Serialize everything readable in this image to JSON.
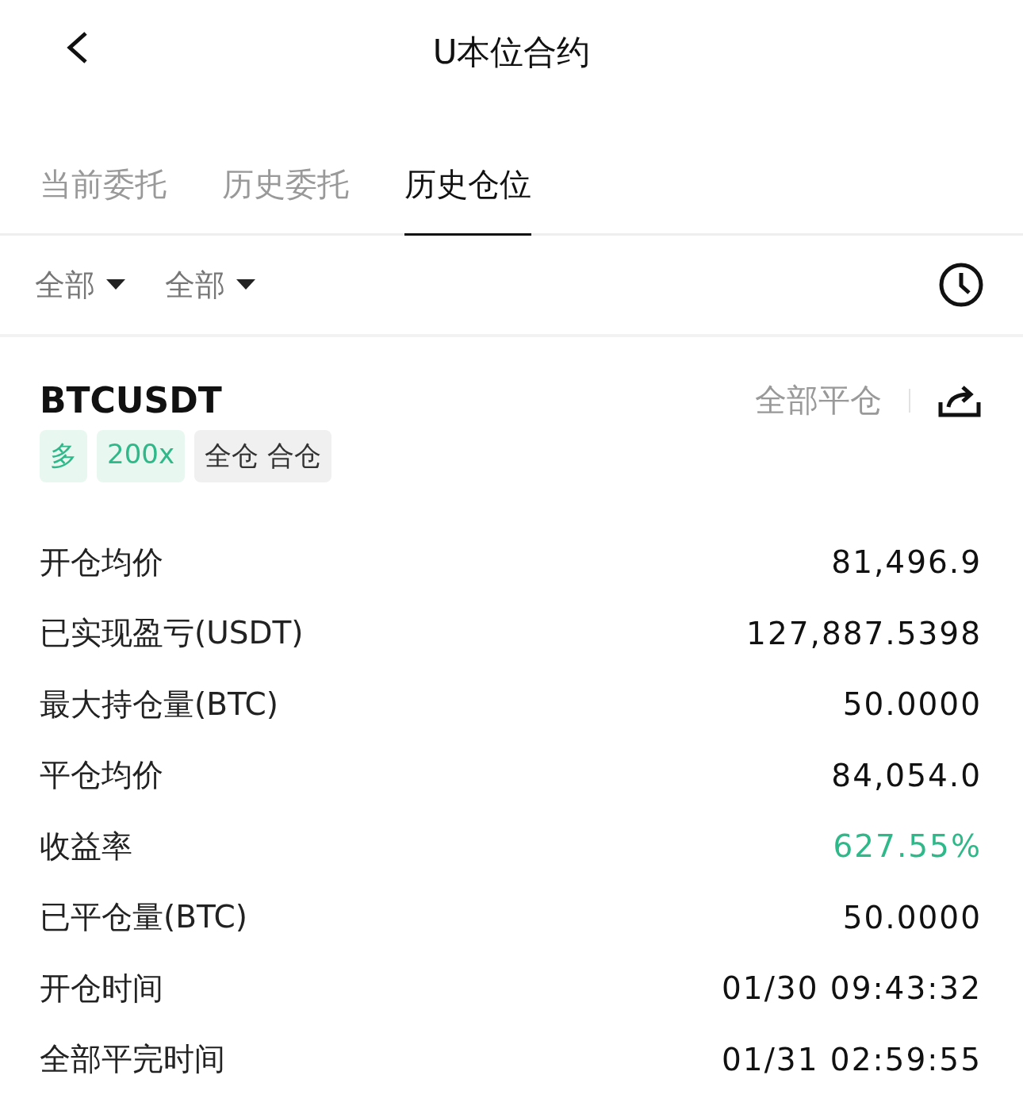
{
  "header": {
    "title": "U本位合约"
  },
  "tabs": [
    {
      "label": "当前委托",
      "selected": false
    },
    {
      "label": "历史委托",
      "selected": false
    },
    {
      "label": "历史仓位",
      "selected": true
    }
  ],
  "filters": [
    {
      "label": "全部"
    },
    {
      "label": "全部"
    }
  ],
  "position": {
    "symbol": "BTCUSDT",
    "close_all": "全部平仓",
    "tags": [
      {
        "label": "多",
        "kind": "long"
      },
      {
        "label": "200x",
        "kind": "leverage"
      },
      {
        "label": "全仓 合仓",
        "kind": "mode"
      }
    ],
    "rows": [
      {
        "label": "开仓均价",
        "value": "81,496.9",
        "kind": "plain"
      },
      {
        "label": "已实现盈亏(USDT)",
        "value": "127,887.5398",
        "kind": "plain"
      },
      {
        "label": "最大持仓量(BTC)",
        "value": "50.0000",
        "kind": "plain"
      },
      {
        "label": "平仓均价",
        "value": "84,054.0",
        "kind": "plain"
      },
      {
        "label": "收益率",
        "value": "627.55%",
        "kind": "profit"
      },
      {
        "label": "已平仓量(BTC)",
        "value": "50.0000",
        "kind": "plain"
      },
      {
        "label": "开仓时间",
        "value": "01/30 09:43:32",
        "kind": "plain"
      },
      {
        "label": "全部平完时间",
        "value": "01/31 02:59:55",
        "kind": "plain"
      }
    ]
  }
}
